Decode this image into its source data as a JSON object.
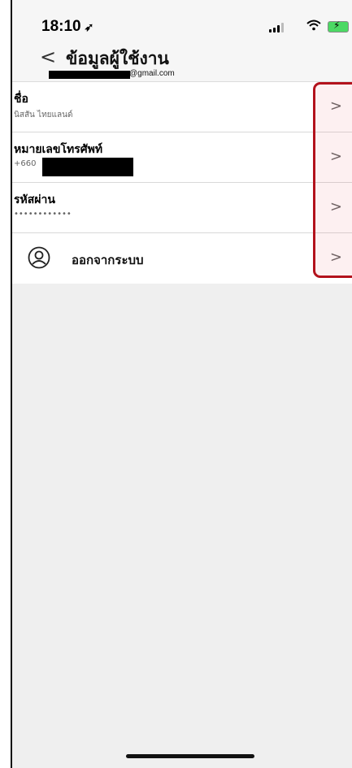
{
  "status_bar": {
    "time": "18:10",
    "location_glyph": "➶",
    "icons": [
      "signal-icon",
      "wifi-icon",
      "battery-charging-icon"
    ]
  },
  "header": {
    "back_glyph": "<",
    "title": "ข้อมูลผู้ใช้งาน",
    "email_visible_suffix": "@gmail.com"
  },
  "items": [
    {
      "label": "ชื่อ",
      "value": "นิสสัน ไทยแลนด์",
      "chevron": ">"
    },
    {
      "label": "หมายเลขโทรศัพท์",
      "value": "+660",
      "chevron": ">"
    },
    {
      "label": "รหัสผ่าน",
      "value": "••••••••••••",
      "chevron": ">"
    },
    {
      "label": "ออกจากระบบ",
      "icon": "user-circle-icon",
      "chevron": ">"
    }
  ],
  "colors": {
    "highlight_border": "#b3121c",
    "background": "#efefef",
    "list_background": "#ffffff"
  }
}
